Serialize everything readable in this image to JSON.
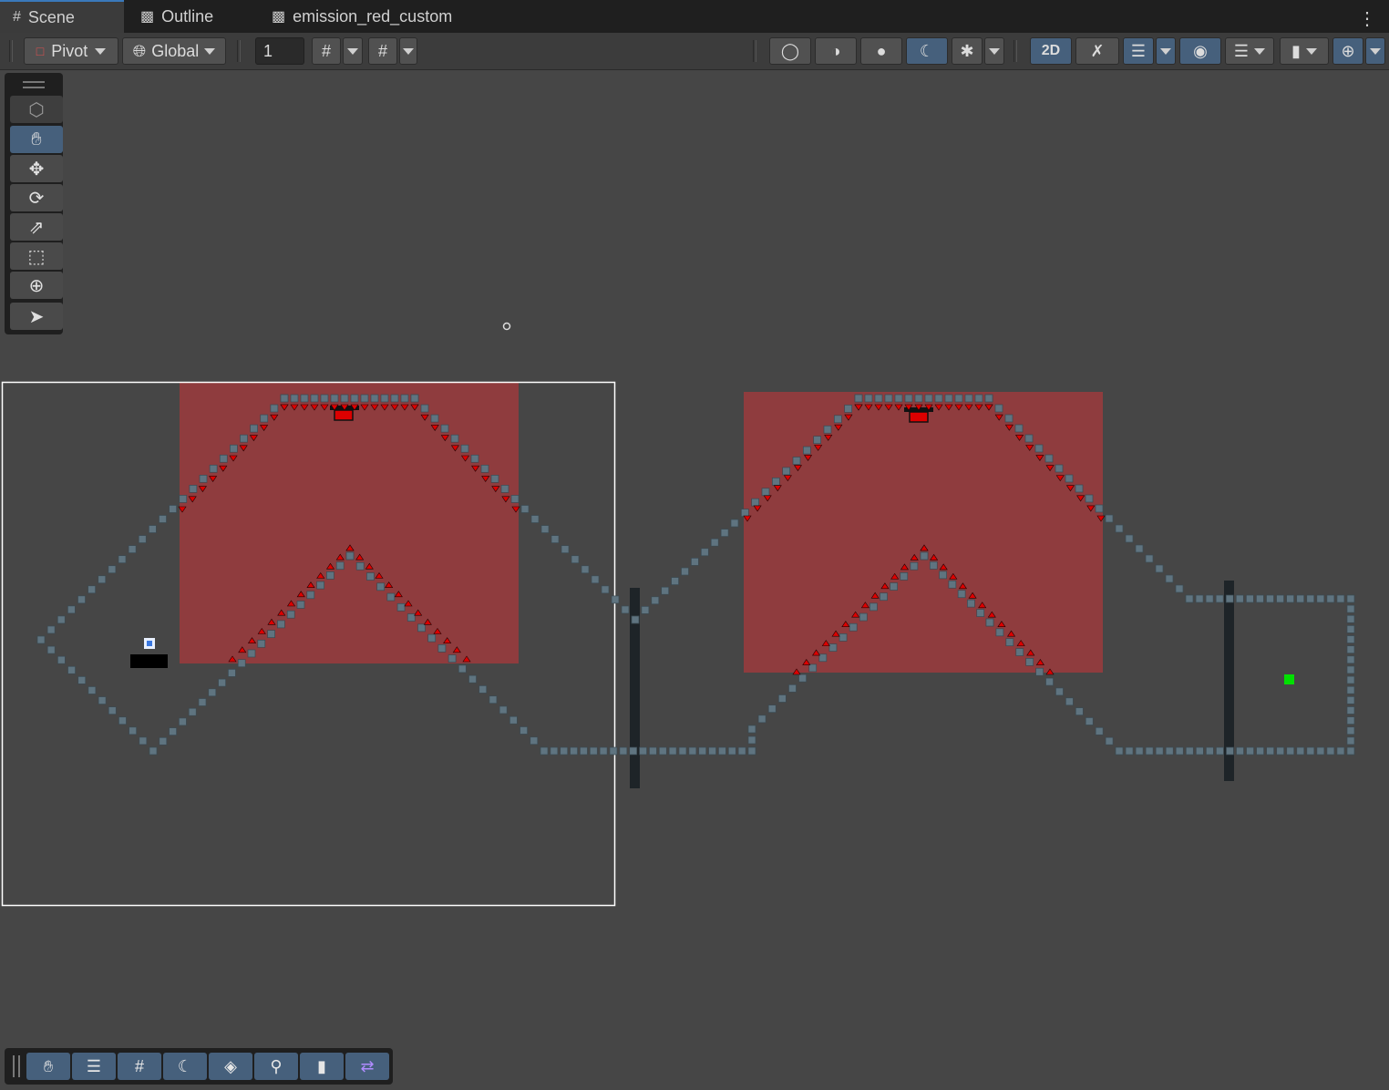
{
  "tabs": [
    {
      "label": "Scene",
      "icon": "hash-icon",
      "active": true
    },
    {
      "label": "Outline",
      "icon": "gameobject-icon",
      "active": false
    },
    {
      "label": "emission_red_custom",
      "icon": "gameobject-icon",
      "active": false
    }
  ],
  "toolbar": {
    "pivot_label": "Pivot",
    "global_label": "Global",
    "grid_size_value": "1",
    "mode_2d_label": "2D"
  },
  "tools": [
    "view-tool",
    "hand-tool",
    "move-tool",
    "rotate-tool",
    "scale-tool",
    "rect-tool",
    "transform-tool",
    "custom-tool"
  ],
  "overlay_bar": [
    "hand-overlay",
    "settings-overlay",
    "grid-overlay",
    "shading-overlay",
    "layers-overlay",
    "search-overlay",
    "camera-overlay",
    "shuffle-overlay"
  ],
  "colors": {
    "background": "#464646",
    "tile": "#5f7480",
    "emission_red": "#8f3c3e",
    "spike_red": "#dd0000",
    "accent_blue": "#46607c",
    "goal_green": "#00e000"
  }
}
